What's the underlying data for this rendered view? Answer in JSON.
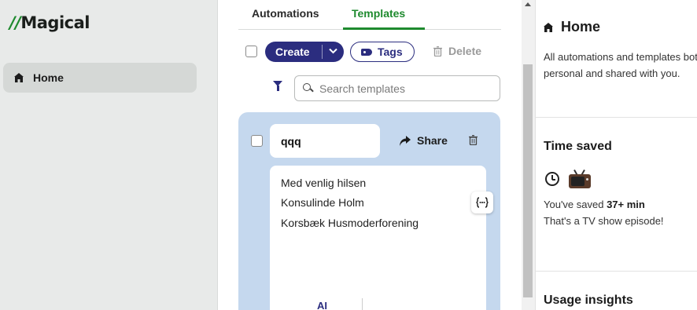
{
  "brand": {
    "logo_prefix": "//",
    "logo_name": "Magical"
  },
  "sidebar": {
    "items": [
      {
        "label": "Home",
        "icon": "home-icon",
        "active": true
      }
    ]
  },
  "tabs": [
    {
      "label": "Automations",
      "active": false
    },
    {
      "label": "Templates",
      "active": true
    }
  ],
  "toolbar": {
    "create_label": "Create",
    "tags_label": "Tags",
    "delete_label": "Delete"
  },
  "search": {
    "placeholder": "Search templates",
    "value": ""
  },
  "template_card": {
    "name": "qqq",
    "share_label": "Share",
    "body_lines": [
      "Med venlig hilsen",
      "Konsulinde Holm",
      "Korsbæk Husmoderforening"
    ],
    "ai_label": "AI"
  },
  "right_panel": {
    "home_title": "Home",
    "home_description": "All automations and templates both personal and shared with you.",
    "time_saved_title": "Time saved",
    "saved_prefix": "You've saved ",
    "saved_amount": "37+ min",
    "saved_note": "That's a TV show episode!",
    "usage_title": "Usage insights"
  },
  "colors": {
    "brand_green": "#1e8a2e",
    "navy": "#2b2d7f",
    "card_blue": "#c5d8ee"
  }
}
